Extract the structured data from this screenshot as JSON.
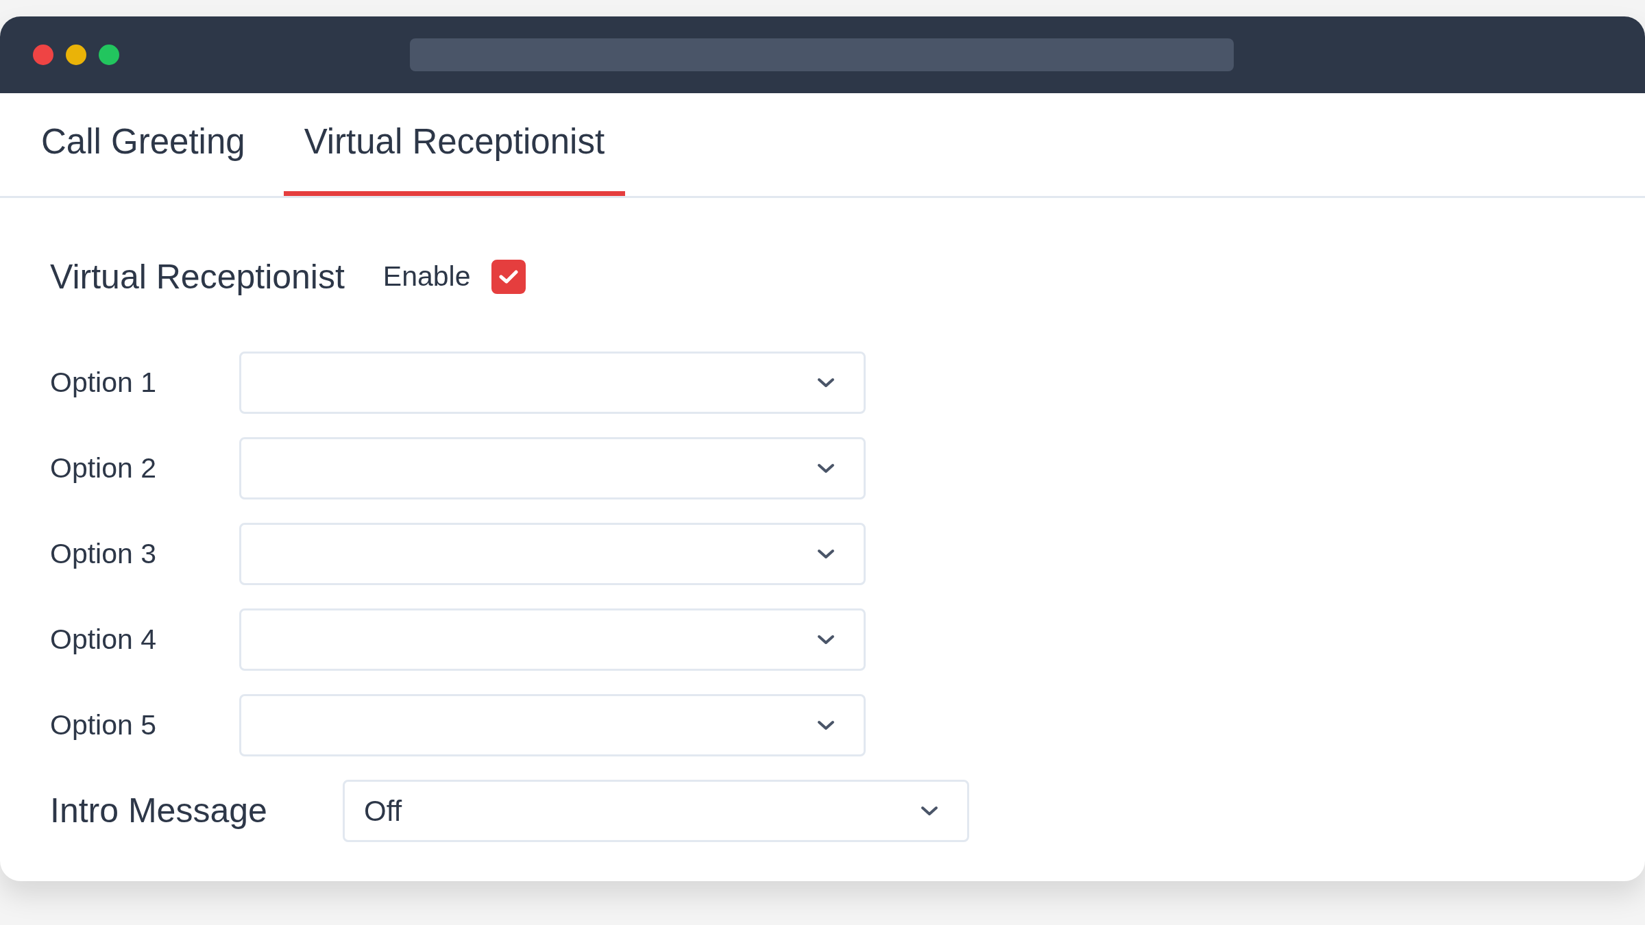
{
  "window": {
    "controls": [
      {
        "color": "#ef4444"
      },
      {
        "color": "#eab308"
      },
      {
        "color": "#22c55e"
      }
    ]
  },
  "tabs": [
    {
      "label": "Call Greeting",
      "selected": false
    },
    {
      "label": "Virtual Receptionist",
      "selected": true
    }
  ],
  "section": {
    "title": "Virtual Receptionist",
    "enable": {
      "label": "Enable",
      "checked": true
    }
  },
  "options": [
    {
      "label": "Option 1"
    },
    {
      "label": "Option 2"
    },
    {
      "label": "Option 3"
    },
    {
      "label": "Option 4"
    },
    {
      "label": "Option 5"
    }
  ],
  "intro": {
    "label": "Intro Message",
    "value": "Off"
  }
}
